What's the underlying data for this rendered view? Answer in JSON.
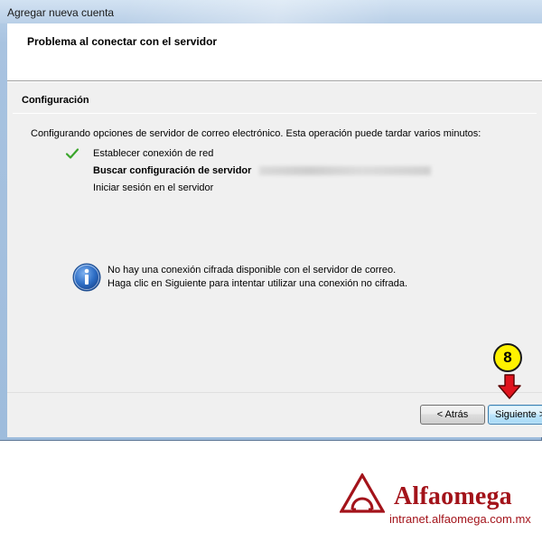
{
  "window": {
    "title": "Agregar nueva cuenta"
  },
  "header": {
    "title": "Problema al conectar con el servidor"
  },
  "section": {
    "title": "Configuración",
    "intro": "Configurando opciones de servidor de correo electrónico. Esta operación puede tardar varios minutos:"
  },
  "steps": [
    {
      "label": "Establecer conexión de red",
      "status": "done",
      "icon": "check-icon"
    },
    {
      "label": "Buscar configuración de servidor",
      "status": "in-progress",
      "icon": ""
    },
    {
      "label": "Iniciar sesión en el servidor",
      "status": "pending",
      "icon": ""
    }
  ],
  "info": {
    "icon": "info-icon",
    "line1": "No hay una conexión cifrada disponible con el servidor de correo.",
    "line2": "Haga clic en Siguiente para intentar utilizar una conexión no cifrada."
  },
  "buttons": {
    "back": "< Atrás",
    "next": "Siguiente >"
  },
  "callout": {
    "number": "8",
    "color": "#fff200",
    "arrow_color": "#e0141e"
  },
  "branding": {
    "name": "Alfaomega",
    "url": "intranet.alfaomega.com.mx",
    "color": "#a3131a"
  }
}
